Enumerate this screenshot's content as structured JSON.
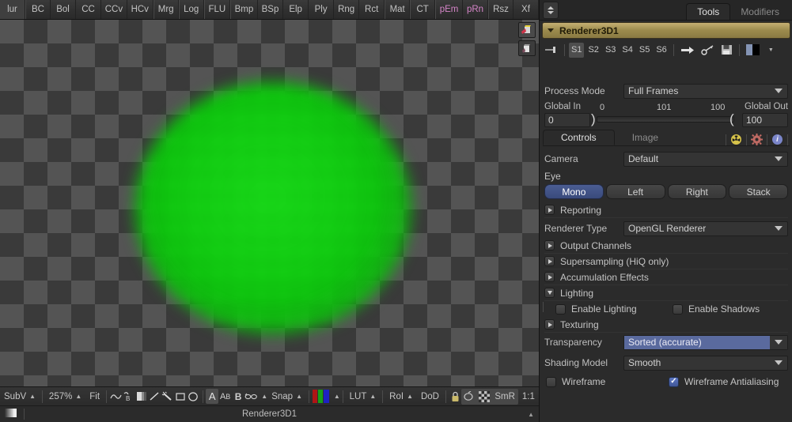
{
  "toolbar": {
    "buttons": [
      {
        "label": "lur",
        "accent": false,
        "group_start": false
      },
      {
        "label": "BC",
        "accent": false,
        "group_start": true
      },
      {
        "label": "Bol",
        "accent": false,
        "group_start": false
      },
      {
        "label": "CC",
        "accent": false,
        "group_start": false
      },
      {
        "label": "CCv",
        "accent": false,
        "group_start": false
      },
      {
        "label": "HCv",
        "accent": false,
        "group_start": false
      },
      {
        "label": "Mrg",
        "accent": false,
        "group_start": true
      },
      {
        "label": "Log",
        "accent": false,
        "group_start": true
      },
      {
        "label": "FLU",
        "accent": false,
        "group_start": true
      },
      {
        "label": "Bmp",
        "accent": false,
        "group_start": true
      },
      {
        "label": "BSp",
        "accent": false,
        "group_start": false
      },
      {
        "label": "Elp",
        "accent": false,
        "group_start": false
      },
      {
        "label": "Ply",
        "accent": false,
        "group_start": false
      },
      {
        "label": "Rng",
        "accent": false,
        "group_start": false
      },
      {
        "label": "Rct",
        "accent": false,
        "group_start": false
      },
      {
        "label": "Mat",
        "accent": false,
        "group_start": true
      },
      {
        "label": "CT",
        "accent": false,
        "group_start": true
      },
      {
        "label": "pEm",
        "accent": true,
        "group_start": true
      },
      {
        "label": "pRn",
        "accent": true,
        "group_start": false
      },
      {
        "label": "Rsz",
        "accent": false,
        "group_start": true
      },
      {
        "label": "Xf",
        "accent": false,
        "group_start": false
      }
    ],
    "accent_color": "#d585c8"
  },
  "viewer": {
    "background": "checkerboard",
    "checker_colors": [
      "#3a3a3a",
      "#545454"
    ],
    "render_color": "#12cc12",
    "corner_buttons": [
      {
        "name": "axis-cube-selected"
      },
      {
        "name": "axis-cube"
      }
    ]
  },
  "view_bar": {
    "subview_label": "SubV",
    "zoom_level": "257%",
    "fit_label": "Fit",
    "icons": [
      {
        "name": "curve-icon",
        "glyph": "∿",
        "selected": false
      },
      {
        "name": "subpixel-icon",
        "glyph": "⑂",
        "selected": false
      },
      {
        "name": "gradient-icon",
        "glyph": "◧",
        "selected": false
      },
      {
        "name": "line-icon",
        "glyph": "╱",
        "selected": false
      },
      {
        "name": "wand-icon",
        "glyph": "✦",
        "selected": false
      },
      {
        "name": "rectangle-icon",
        "glyph": "□",
        "selected": false
      },
      {
        "name": "ellipse-icon",
        "glyph": "○",
        "selected": false
      }
    ],
    "text_icons": [
      {
        "name": "text-a-icon",
        "glyph": "A",
        "selected": true
      },
      {
        "name": "text-ab-icon",
        "glyph": "ᴬʙ",
        "selected": false
      },
      {
        "name": "text-bold-icon",
        "glyph": "B",
        "selected": false
      }
    ],
    "glasses_label": "",
    "snap_label": "Snap",
    "channels_label": "RGB",
    "lut_label": "LUT",
    "roi_label": "RoI",
    "dod_label": "DoD",
    "lock_icon": "lock-icon",
    "smr_label": "SmR",
    "ratio_label": "1:1"
  },
  "status_bar": {
    "node_name": "Renderer3D1",
    "left_icon": "gradient-swatch-icon"
  },
  "inspector": {
    "tabs": [
      {
        "label": "Tools",
        "active": true
      },
      {
        "label": "Modifiers",
        "active": false
      }
    ],
    "node": {
      "title": "Renderer3D1",
      "header_color": "#9c8b4d"
    },
    "node_icon_row": {
      "pin_icon": "pin-icon",
      "states": [
        {
          "label": "S1",
          "selected": true
        },
        {
          "label": "S2",
          "selected": false
        },
        {
          "label": "S3",
          "selected": false
        },
        {
          "label": "S4",
          "selected": false
        },
        {
          "label": "S5",
          "selected": false
        },
        {
          "label": "S6",
          "selected": false
        }
      ],
      "arrow_icon": "arrow-right-icon",
      "key_icon": "key-icon",
      "save_icon": "floppy-disk-icon",
      "color_swatch_icon": "color-swatch-icon"
    },
    "process_mode": {
      "label": "Process Mode",
      "value": "Full Frames"
    },
    "range": {
      "global_in_label": "Global In",
      "global_in_value": "0",
      "global_out_label": "Global Out",
      "global_out_value": "100",
      "tick_start": "0",
      "tick_mid": "101",
      "tick_end": "100"
    },
    "subtabs": [
      {
        "label": "Controls",
        "active": true
      },
      {
        "label": "Image",
        "active": false
      }
    ],
    "subtab_icons": [
      {
        "name": "hazard-icon",
        "color": "#d6c24a"
      },
      {
        "name": "gear-icon",
        "color": "#c06a63"
      },
      {
        "name": "info-icon",
        "color": "#7a85c9"
      }
    ],
    "camera": {
      "label": "Camera",
      "value": "Default"
    },
    "eye": {
      "label": "Eye",
      "options": [
        {
          "label": "Mono",
          "active": true
        },
        {
          "label": "Left",
          "active": false
        },
        {
          "label": "Right",
          "active": false
        },
        {
          "label": "Stack",
          "active": false
        }
      ]
    },
    "reporting": {
      "label": "Reporting",
      "expanded": false
    },
    "renderer_type": {
      "label": "Renderer Type",
      "value": "OpenGL Renderer"
    },
    "sections": [
      {
        "label": "Output Channels",
        "expanded": false
      },
      {
        "label": "Supersampling (HiQ only)",
        "expanded": false
      },
      {
        "label": "Accumulation Effects",
        "expanded": false
      },
      {
        "label": "Lighting",
        "expanded": true
      }
    ],
    "lighting": {
      "enable_lighting": {
        "label": "Enable Lighting",
        "checked": false
      },
      "enable_shadows": {
        "label": "Enable Shadows",
        "checked": false
      }
    },
    "texturing": {
      "label": "Texturing",
      "expanded": false
    },
    "transparency": {
      "label": "Transparency",
      "value": "Sorted (accurate)",
      "highlighted": true,
      "highlight_color": "#5a6a9e"
    },
    "shading_model": {
      "label": "Shading Model",
      "value": "Smooth"
    },
    "wireframe": {
      "label": "Wireframe",
      "checked": false
    },
    "wireframe_antialiasing": {
      "label": "Wireframe Antialiasing",
      "checked": true
    }
  }
}
